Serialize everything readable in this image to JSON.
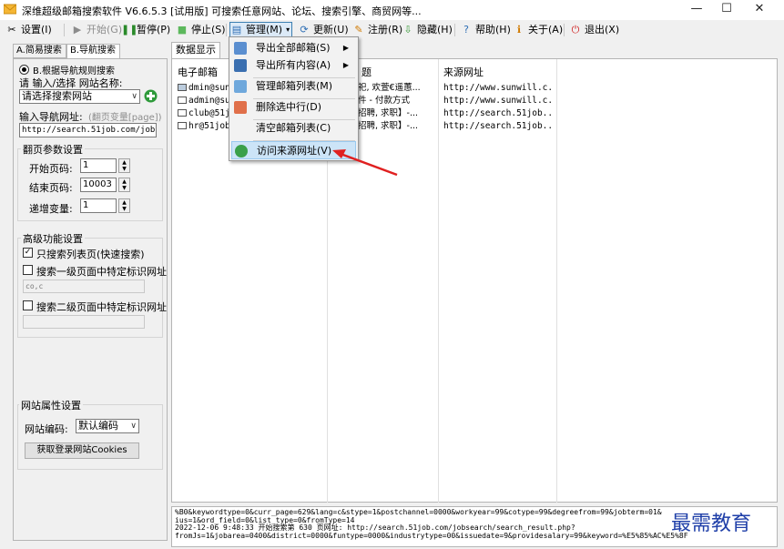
{
  "window": {
    "title": "深维超级邮箱搜索软件 V6.6.5.3 [试用版] 可搜索任意网站、论坛、搜索引擎、商贸网等...",
    "minimize": "—",
    "maximize": "☐",
    "close": "✕"
  },
  "toolbar": {
    "settings": "设置(I)",
    "start": "开始(G)",
    "pause": "暂停(P)",
    "stop": "停止(S)",
    "manage": "管理(M)",
    "update": "更新(U)",
    "register": "注册(R)",
    "hide": "隐藏(H)",
    "help": "帮助(H)",
    "about": "关于(A)",
    "exit": "退出(X)"
  },
  "left_tabs": [
    "A.简易搜索",
    "B.导航搜索"
  ],
  "left_panel": {
    "radio_label": "B.根据导航规则搜索",
    "site_name_label": "请 输入/选择 网站名称:",
    "site_select": "请选择搜索网站",
    "nav_url_label": "输入导航网址:",
    "nav_url_hint": "(翻页变量[page])",
    "nav_url_value": "http://search.51job.com/jobse",
    "paging_title": "翻页参数设置",
    "start_page_label": "开始页码:",
    "start_page": "1",
    "end_page_label": "结束页码:",
    "end_page": "10003",
    "step_label": "递增变量:",
    "step": "1",
    "advanced_title": "高级功能设置",
    "only_list_label": "只搜索列表页(快速搜索)",
    "search_level1_label": "搜索一级页面中特定标识网址",
    "level1_value": "co,c",
    "search_level2_label": "搜索二级页面中特定标识网址",
    "site_props_title": "网站属性设置",
    "encoding_label": "网站编码:",
    "encoding_value": "默认编码",
    "cookies_button": "获取登录网站Cookies"
  },
  "right": {
    "tab": "数据显示",
    "columns": [
      "电子邮箱",
      "题",
      "来源网址"
    ],
    "rows": [
      {
        "email": "dmin@sunv",
        "title": "祀, 欢萱€遥蕙...",
        "url": "http://www.sunwill.c..."
      },
      {
        "email": "admin@sun",
        "title": "件 - 付款方式",
        "url": "http://www.sunwill.c..."
      },
      {
        "email": "club@51jo",
        "title": "招聘, 求职】-...",
        "url": "http://search.51job...."
      },
      {
        "email": "hr@51job",
        "title": "招聘, 求职】-...",
        "url": "http://search.51job...."
      }
    ]
  },
  "menu": {
    "items": [
      {
        "label": "导出全部邮箱(S)",
        "sub": "▶"
      },
      {
        "label": "导出所有内容(A)",
        "sub": "▶"
      },
      {
        "label": "管理邮箱列表(M)",
        "sub": ""
      },
      {
        "label": "删除选中行(D)",
        "sub": ""
      },
      {
        "label": "清空邮箱列表(C)",
        "sub": ""
      },
      {
        "label": "访问来源网址(V)",
        "sub": ""
      }
    ]
  },
  "log": {
    "lines": [
      "%B0&keywordtype=0&curr_page=629&lang=c&stype=1&postchannel=0000&workyear=99&cotype=99&degreefrom=99&jobterm=01&",
      "ius=1&ord_field=0&list_type=0&fromType=14",
      "2022-12-06 9:48:33 开始搜索第 630 页网址: http://search.51job.com/jobsearch/search_result.php?",
      "fromJs=1&jobarea=0400&district=0000&funtype=0000&industrytype=00&issuedate=9&providesalary=99&keyword=%E5%85%AC%E5%8F"
    ]
  },
  "watermark": "最需教育",
  "colors": {
    "accent": "#3c7fb1",
    "arrow": "#e02020",
    "watermark": "#1f3fa8"
  }
}
